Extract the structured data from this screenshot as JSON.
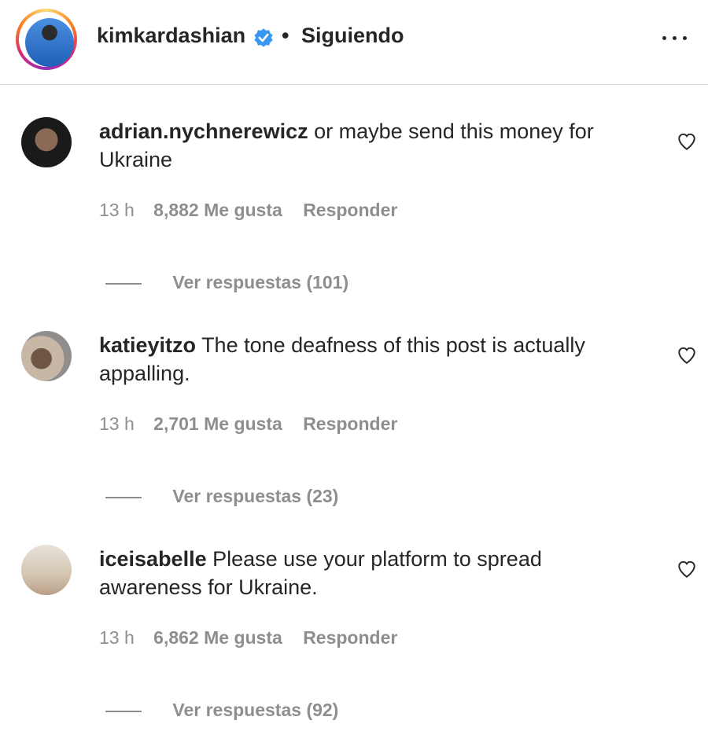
{
  "header": {
    "username": "kimkardashian",
    "separator": "•",
    "follow_status": "Siguiendo"
  },
  "comments": [
    {
      "username": "adrian.nychnerewicz",
      "text": "or maybe send this money for Ukraine",
      "time": "13 h",
      "likes": "8,882 Me gusta",
      "reply": "Responder",
      "view_replies": "Ver respuestas (101)"
    },
    {
      "username": "katieyitzo",
      "text": "The tone deafness of this post is actually appalling.",
      "time": "13 h",
      "likes": "2,701 Me gusta",
      "reply": "Responder",
      "view_replies": "Ver respuestas (23)"
    },
    {
      "username": "iceisabelle",
      "text": "Please use your platform to spread awareness for Ukraine.",
      "time": "13 h",
      "likes": "6,862 Me gusta",
      "reply": "Responder",
      "view_replies": "Ver respuestas (92)"
    }
  ],
  "icons": {
    "verified": "verified-badge-icon",
    "more": "more-options-icon",
    "like": "heart-outline-icon"
  },
  "colors": {
    "text": "#262626",
    "secondary": "#8e8e8e",
    "verified": "#3897f0",
    "divider": "#dbdbdb"
  }
}
